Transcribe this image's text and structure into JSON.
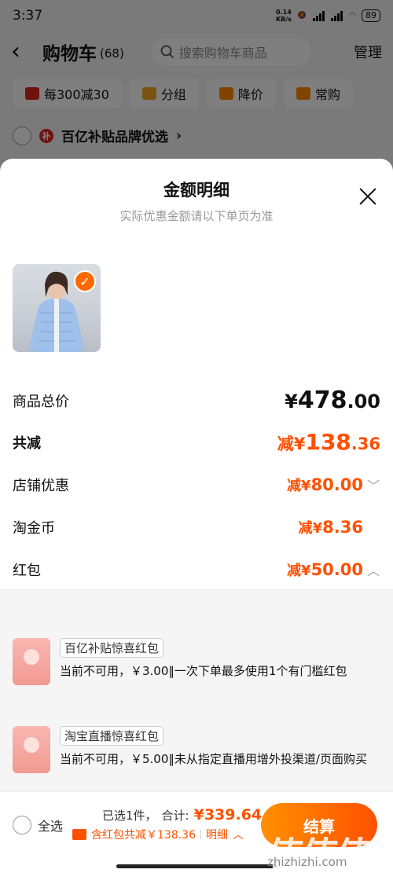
{
  "status_bar": {
    "time": "3:37",
    "net_speed": "0.14",
    "net_unit": "KB/s",
    "battery": "89"
  },
  "header": {
    "title": "购物车",
    "count": "(68)",
    "search_placeholder": "搜索购物车商品",
    "manage": "管理"
  },
  "filters": [
    {
      "label": "每300减30",
      "icon": "shop-promo-icon",
      "color": "#e1251b"
    },
    {
      "label": "分组",
      "icon": "folder-icon",
      "color": "#f5a623"
    },
    {
      "label": "降价",
      "icon": "price-drop-icon",
      "color": "#ff8a00"
    },
    {
      "label": "常购",
      "icon": "cart-icon",
      "color": "#ff8a00"
    }
  ],
  "brand_row": {
    "badge": "补",
    "label": "百亿补贴品牌优选"
  },
  "sheet": {
    "title": "金额明细",
    "subtitle": "实际优惠金额请以下单页为准",
    "rows": {
      "total": {
        "label": "商品总价",
        "symbol": "¥",
        "int": "478",
        "dec": ".00"
      },
      "reduced": {
        "label": "共减",
        "prefix": "减¥",
        "int": "138",
        "dec": ".36"
      },
      "shop": {
        "label": "店铺优惠",
        "prefix": "减¥",
        "value": "80.00"
      },
      "coins": {
        "label": "淘金币",
        "prefix": "减¥",
        "value": "8.36"
      },
      "redpacket": {
        "label": "红包",
        "prefix": "减¥",
        "value": "50.00"
      }
    },
    "packets": [
      {
        "tag": "百亿补贴惊喜红包",
        "desc": "当前不可用，￥3.00‖一次下单最多使用1个有门槛红包"
      },
      {
        "tag": "淘宝直播惊喜红包",
        "desc": "当前不可用，￥5.00‖未从指定直播用增外投渠道/页面购买"
      }
    ]
  },
  "bottom_bar": {
    "select_all": "全选",
    "selected": "已选1件，",
    "total_label": "合计:",
    "total_value": "¥339.64",
    "discount_text": "含红包共减￥138.36",
    "detail_label": "明细",
    "checkout": "结算"
  },
  "watermark": {
    "text": "值值值",
    "url": "zhizhizhi.com"
  },
  "colors": {
    "accent": "#ff5000",
    "checkout_gradient_start": "#ff9000"
  }
}
